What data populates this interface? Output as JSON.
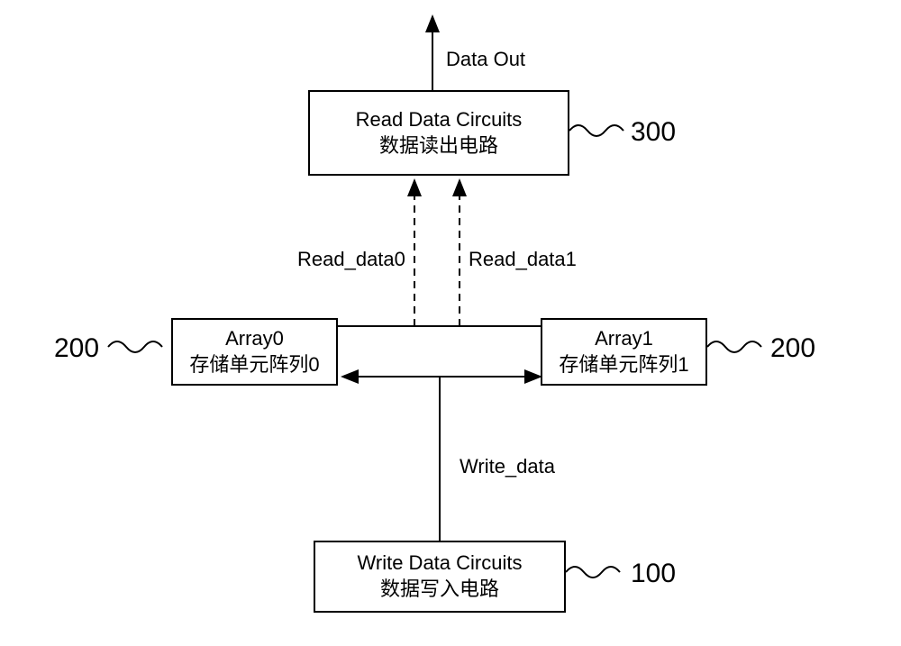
{
  "blocks": {
    "read": {
      "line1": "Read Data Circuits",
      "line2": "数据读出电路",
      "ref": "300"
    },
    "array0": {
      "line1": "Array0",
      "line2": "存储单元阵列0",
      "ref": "200"
    },
    "array1": {
      "line1": "Array1",
      "line2": "存储单元阵列1",
      "ref": "200"
    },
    "write": {
      "line1": "Write Data Circuits",
      "line2": "数据写入电路",
      "ref": "100"
    }
  },
  "labels": {
    "data_out": "Data Out",
    "read_data0": "Read_data0",
    "read_data1": "Read_data1",
    "write_data": "Write_data"
  }
}
